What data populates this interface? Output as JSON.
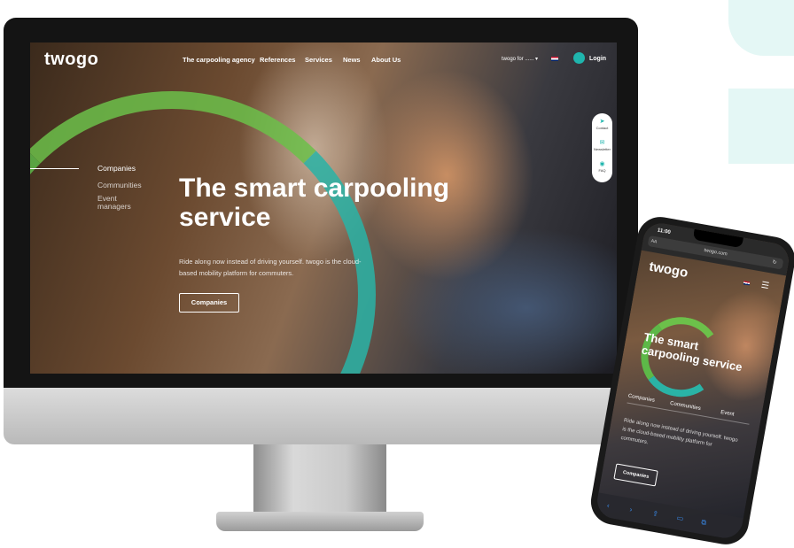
{
  "desktop": {
    "logo": "twogo",
    "nav": [
      "The carpooling agency",
      "References",
      "Services",
      "News",
      "About Us"
    ],
    "language_selector": "twogo for ...... ▾",
    "login": "Login",
    "side_nav": [
      "Companies",
      "Communities",
      "Event",
      "managers"
    ],
    "headline_line1": "The smart carpooling",
    "headline_line2": "service",
    "subtext_line1": "Ride along now instead of driving yourself. twogo is the cloud-",
    "subtext_line2": "based mobility platform for commuters.",
    "cta": "Companies",
    "widget": {
      "contact": "Contact",
      "newsletter": "Newsletter",
      "faq": "FAQ"
    }
  },
  "mobile": {
    "time": "11:00",
    "address_aa": "AA",
    "url": "twogo.com",
    "logo": "twogo",
    "headline_line1": "The smart",
    "headline_line2": "carpooling service",
    "tabs": [
      "Companies",
      "Communities",
      "Event"
    ],
    "subtext_line1": "Ride along now instead of driving yourself. twogo",
    "subtext_line2": "is the cloud-based mobility platform for",
    "subtext_line3": "commuters.",
    "cta": "Companies"
  },
  "colors": {
    "accent_teal": "#1fb5ad",
    "accent_green": "#6cc04a",
    "decor_teal": "#e4f7f5"
  },
  "icons": [
    "send-icon",
    "mail-icon",
    "faq-icon",
    "user-icon",
    "menu-icon",
    "refresh-icon",
    "share-icon",
    "book-icon",
    "tabs-icon"
  ]
}
